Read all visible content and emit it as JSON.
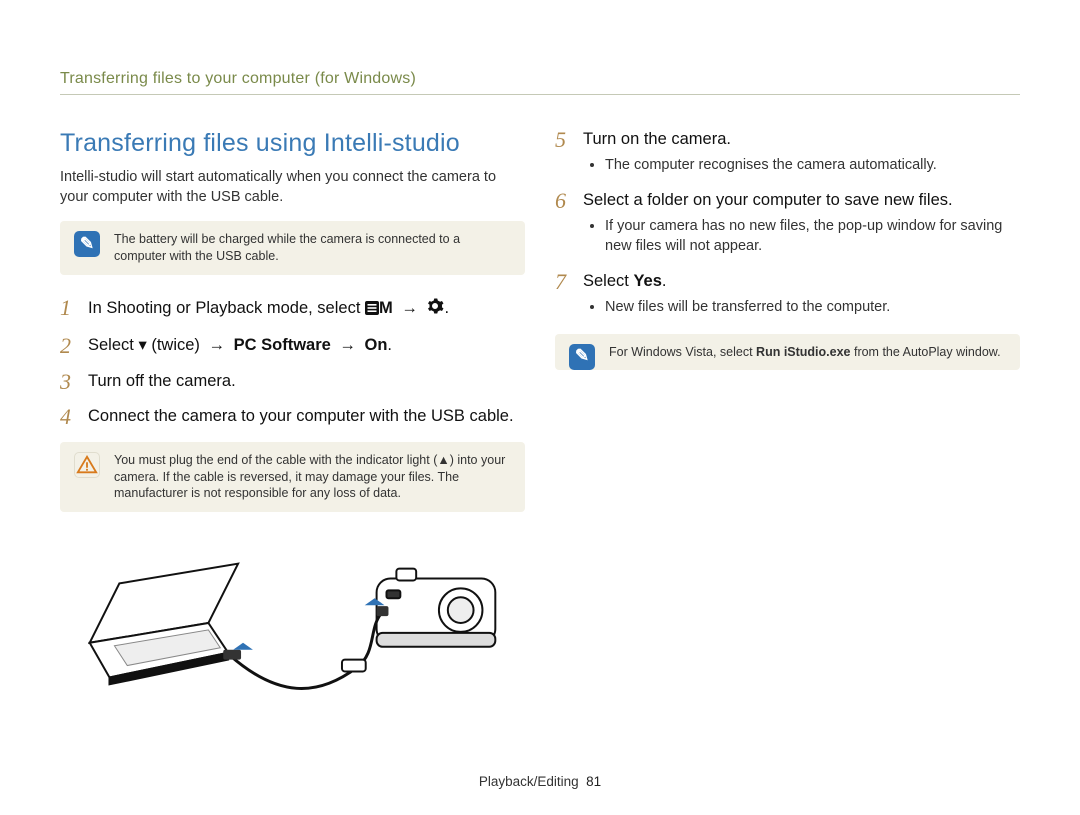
{
  "breadcrumb": "Transferring files to your computer (for Windows)",
  "section_title": "Transferring ﬁles using Intelli-studio",
  "intro": "Intelli-studio will start automatically when you connect the camera to your computer with the USB cable.",
  "note1": "The battery will be charged while the camera is connected to a computer with the USB cable.",
  "steps_left": {
    "s1a": "In Shooting or Playback mode, select ",
    "s1b": "M",
    "s1c": ".",
    "s2a": "Select ",
    "s2b": " (twice) ",
    "s2c": "PC Software",
    "s2d": "On",
    "s2e": ".",
    "s3": "Turn off the camera.",
    "s4": "Connect the camera to your computer with the USB cable."
  },
  "warn": "You must plug the end of the cable with the indicator light (▲) into your camera. If the cable is reversed, it may damage your files. The manufacturer is not responsible for any loss of data.",
  "steps_right": {
    "s5": "Turn on the camera.",
    "s5_sub": "The computer recognises the camera automatically.",
    "s6": "Select a folder on your computer to save new ﬁles.",
    "s6_sub": "If your camera has no new files, the pop-up window for saving new files will not appear.",
    "s7a": "Select ",
    "s7b": "Yes",
    "s7c": ".",
    "s7_sub": "New files will be transferred to the computer."
  },
  "note2a": "For Windows Vista, select ",
  "note2b": "Run iStudio.exe",
  "note2c": " from the AutoPlay window.",
  "footer_section": "Playback/Editing",
  "footer_page": "81",
  "arrow": "→",
  "down_glyph": "▾",
  "note_icon_glyph": "✎"
}
